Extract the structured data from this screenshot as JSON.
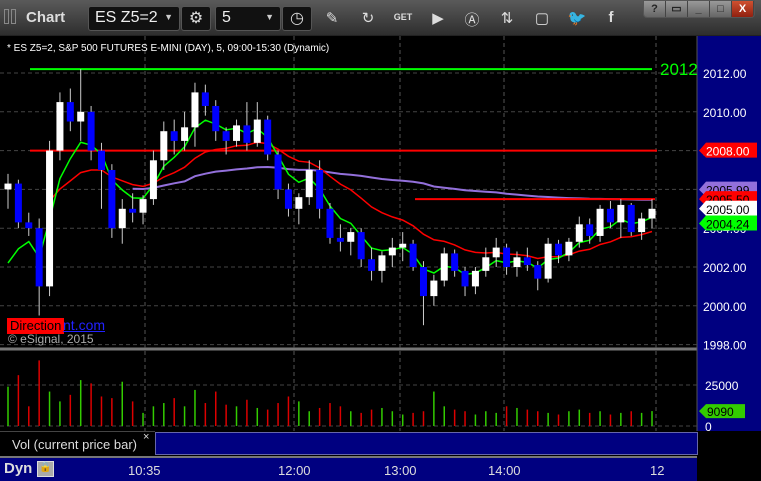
{
  "window": {
    "title": "Chart",
    "symbol": "ES Z5=2",
    "interval": "5",
    "controls": [
      "?",
      "restore",
      "minimize",
      "maximize",
      "X"
    ]
  },
  "toolbar_icons": [
    "pencil-icon",
    "study-icon",
    "get-icon",
    "play-icon",
    "alert-icon",
    "swap-icon",
    "comment-icon",
    "twitter-icon",
    "facebook-icon"
  ],
  "chart": {
    "description": "* ES Z5=2, S&P 500 FUTURES E-MINI (DAY), 5, 09:00-15:30 (Dynamic)",
    "direction_label": "Direction",
    "direction_link": "nt.com",
    "copyright": "© eSignal, 2015",
    "level_label": "2012",
    "price_ticks": [
      "2012.00",
      "2010.00",
      "2008.00",
      "2006.00",
      "2004.00",
      "2002.00",
      "2000.00",
      "1998.00"
    ],
    "price_tick_values": [
      2012,
      2010,
      2008,
      2006,
      2004,
      2002,
      2000,
      1998
    ],
    "price_flags": [
      {
        "label": "2008.00",
        "value": 2008,
        "bg": "#ff0000",
        "fg": "#ffffff"
      },
      {
        "label": "2005.99",
        "value": 2005.99,
        "bg": "#9370db",
        "fg": "#000000"
      },
      {
        "label": "2005.50",
        "value": 2005.5,
        "bg": "#ff0000",
        "fg": "#000000"
      },
      {
        "label": "2005.00",
        "value": 2005.0,
        "bg": "#ffffff",
        "fg": "#000000"
      },
      {
        "label": "2004.24",
        "value": 2004.24,
        "bg": "#00ff00",
        "fg": "#000000"
      }
    ],
    "hlines": [
      {
        "value": 2012.2,
        "color": "#00ff00"
      },
      {
        "value": 2008,
        "color": "#ff0000"
      }
    ],
    "ohlc": [
      [
        2006,
        2006.8,
        2005,
        2006.3
      ],
      [
        2006.3,
        2006.5,
        2004,
        2004.3
      ],
      [
        2004.3,
        2004.8,
        2003.6,
        2004
      ],
      [
        2004,
        2004.5,
        1999.5,
        2001
      ],
      [
        2001,
        2008.5,
        2000.5,
        2008
      ],
      [
        2008,
        2011,
        2007.5,
        2010.5
      ],
      [
        2010.5,
        2011.2,
        2009,
        2009.5
      ],
      [
        2009.5,
        2012.2,
        2008.5,
        2010
      ],
      [
        2010,
        2010.3,
        2007.5,
        2008
      ],
      [
        2008,
        2008.4,
        2005,
        2007
      ],
      [
        2007,
        2007.3,
        2003.5,
        2004
      ],
      [
        2004,
        2005.5,
        2003.2,
        2005
      ],
      [
        2005,
        2005.8,
        2004.3,
        2004.8
      ],
      [
        2004.8,
        2005.7,
        2004.2,
        2005.5
      ],
      [
        2005.5,
        2008,
        2005.2,
        2007.5
      ],
      [
        2007.5,
        2009.5,
        2007,
        2009
      ],
      [
        2009,
        2009.6,
        2007.8,
        2008.5
      ],
      [
        2008.5,
        2010,
        2008,
        2009.2
      ],
      [
        2009.2,
        2011.5,
        2008.2,
        2011
      ],
      [
        2011,
        2011.4,
        2009.8,
        2010.3
      ],
      [
        2010.3,
        2010.6,
        2008.5,
        2009
      ],
      [
        2009,
        2009.2,
        2007.8,
        2008.5
      ],
      [
        2008.5,
        2009.6,
        2008.2,
        2009.3
      ],
      [
        2009.3,
        2010.5,
        2008,
        2008.4
      ],
      [
        2008.4,
        2010.5,
        2008.2,
        2009.6
      ],
      [
        2009.6,
        2009.8,
        2007.5,
        2007.8
      ],
      [
        2007.8,
        2008,
        2005.5,
        2006
      ],
      [
        2006,
        2006.3,
        2004.6,
        2005
      ],
      [
        2005,
        2005.8,
        2004.2,
        2005.6
      ],
      [
        2005.6,
        2007.5,
        2005.2,
        2007
      ],
      [
        2007,
        2007.5,
        2004.5,
        2005
      ],
      [
        2005,
        2005.3,
        2003.2,
        2003.5
      ],
      [
        2003.5,
        2004.2,
        2002.8,
        2003.3
      ],
      [
        2003.3,
        2004,
        2002.6,
        2003.8
      ],
      [
        2003.8,
        2004,
        2002,
        2002.4
      ],
      [
        2002.4,
        2003,
        2001.3,
        2001.8
      ],
      [
        2001.8,
        2002.8,
        2001.2,
        2002.6
      ],
      [
        2002.6,
        2003.5,
        2002,
        2003
      ],
      [
        2003,
        2003.8,
        2002.3,
        2003.2
      ],
      [
        2003.2,
        2003.4,
        2001.8,
        2002
      ],
      [
        2002,
        2002.3,
        1999,
        2000.5
      ],
      [
        2000.5,
        2001.6,
        2000,
        2001.3
      ],
      [
        2001.3,
        2003,
        2001,
        2002.7
      ],
      [
        2002.7,
        2002.9,
        2001.5,
        2001.8
      ],
      [
        2001.8,
        2002,
        2000.5,
        2001
      ],
      [
        2001,
        2002,
        2000.6,
        2001.8
      ],
      [
        2001.8,
        2003,
        2001.5,
        2002.5
      ],
      [
        2002.5,
        2003.5,
        2002,
        2003
      ],
      [
        2003,
        2003.2,
        2001.6,
        2002
      ],
      [
        2002,
        2002.8,
        2001.5,
        2002.5
      ],
      [
        2002.5,
        2003,
        2001.8,
        2002.1
      ],
      [
        2002.1,
        2002.3,
        2000.8,
        2001.4
      ],
      [
        2001.4,
        2003.5,
        2001.2,
        2003.2
      ],
      [
        2003.2,
        2003.4,
        2002.2,
        2002.6
      ],
      [
        2002.6,
        2003.5,
        2002.3,
        2003.3
      ],
      [
        2003.3,
        2004.6,
        2003,
        2004.2
      ],
      [
        2004.2,
        2004.5,
        2003.2,
        2003.6
      ],
      [
        2003.6,
        2005.2,
        2003.3,
        2005
      ],
      [
        2005,
        2005.4,
        2004,
        2004.3
      ],
      [
        2004.3,
        2005.5,
        2003.5,
        2005.2
      ],
      [
        2005.2,
        2005.3,
        2003.6,
        2003.8
      ],
      [
        2003.8,
        2004.8,
        2003.4,
        2004.5
      ],
      [
        2004.5,
        2005.5,
        2004,
        2005
      ]
    ],
    "volume": [
      24000,
      31000,
      12000,
      40000,
      21000,
      15000,
      19000,
      28000,
      26000,
      18000,
      17000,
      27000,
      15000,
      8000,
      12000,
      14000,
      17000,
      12000,
      22000,
      14000,
      21000,
      13000,
      12000,
      16000,
      11000,
      10000,
      14000,
      18000,
      15000,
      9000,
      11000,
      14000,
      12000,
      9000,
      8000,
      10000,
      11000,
      9000,
      7000,
      8000,
      9000,
      21000,
      12000,
      10000,
      9000,
      7000,
      9000,
      8000,
      12000,
      11000,
      10000,
      9000,
      8000,
      7000,
      9000,
      10000,
      8000,
      9000,
      7000,
      8000,
      9000,
      8000,
      9090
    ],
    "volume_ticks": [
      "25000",
      "0"
    ],
    "volume_tick_values": [
      25000,
      0
    ],
    "volume_flag": "9090",
    "vol_label": "Vol (current price bar)",
    "vol_close": "×",
    "time_ticks": [
      "10:35",
      "12:00",
      "13:00",
      "14:00",
      "12"
    ],
    "dyn_label": "Dyn"
  },
  "colors": {
    "up": "#ffffff",
    "down": "#0000ff",
    "axis_bg": "#000080",
    "vol_up": "#33cc00",
    "vol_down": "#dd0000",
    "ema_fast": "#00ff00",
    "ema_slow": "#ff0000",
    "vwap": "#9370db"
  }
}
